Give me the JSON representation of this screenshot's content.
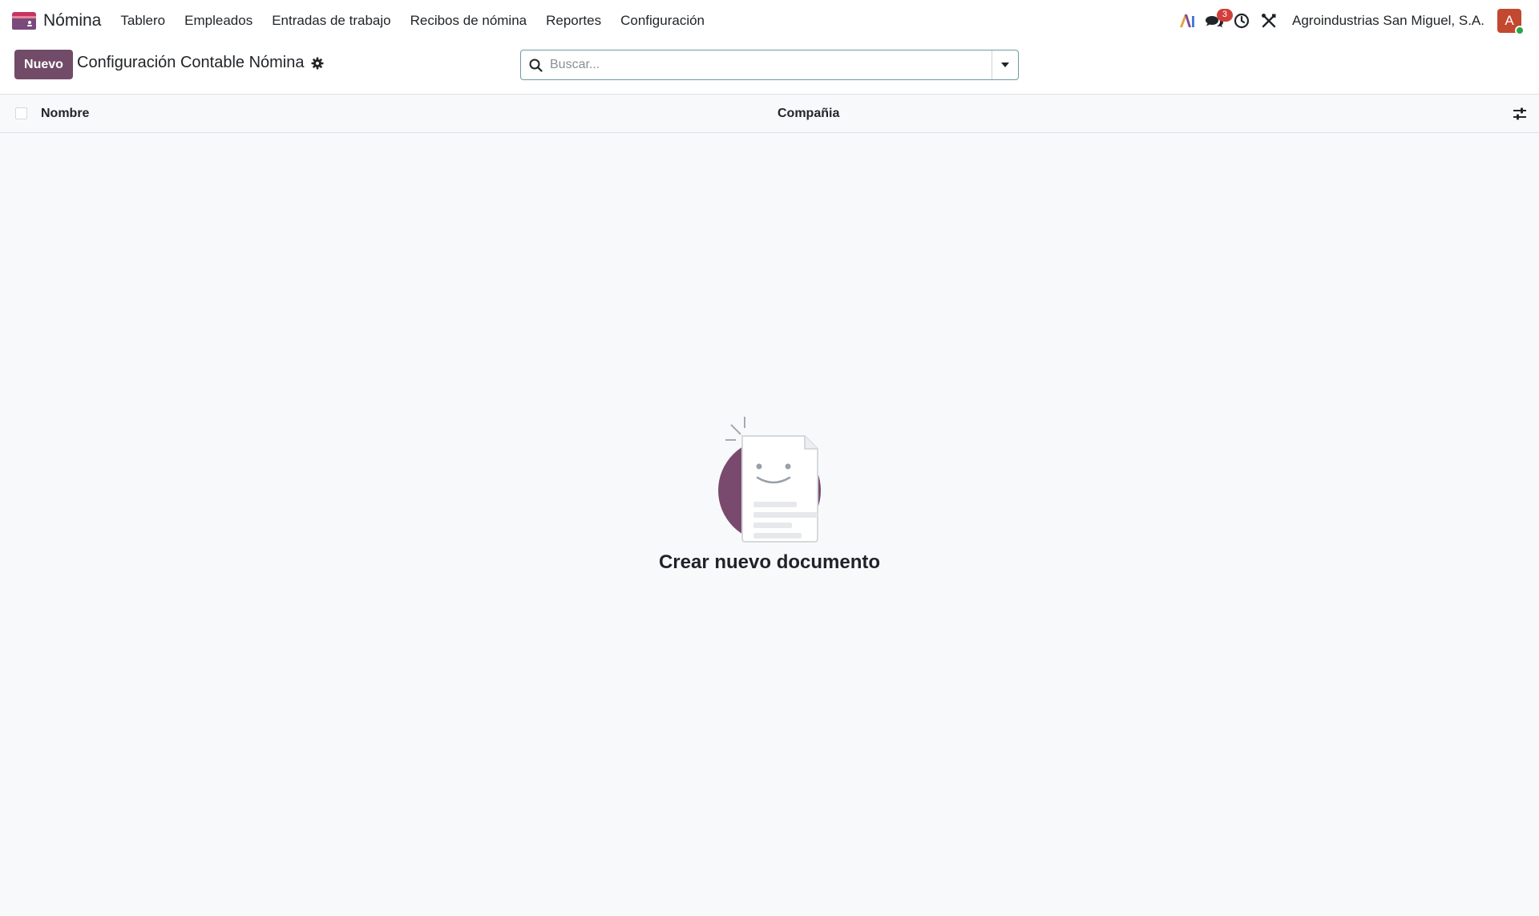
{
  "navbar": {
    "app_name": "Nómina",
    "menu": [
      {
        "label": "Tablero"
      },
      {
        "label": "Empleados"
      },
      {
        "label": "Entradas de trabajo"
      },
      {
        "label": "Recibos de nómina"
      },
      {
        "label": "Reportes"
      },
      {
        "label": "Configuración"
      }
    ],
    "messages_badge": "3",
    "company": "Agroindustrias San Miguel, S.A.",
    "avatar_initial": "A",
    "icons": [
      "ai-icon",
      "chat-icon",
      "clock-icon",
      "tools-icon"
    ]
  },
  "control_panel": {
    "new_label": "Nuevo",
    "title": "Configuración Contable Nómina",
    "search_placeholder": "Buscar..."
  },
  "table": {
    "columns": [
      {
        "label": "Nombre"
      },
      {
        "label": "Compañia"
      }
    ]
  },
  "empty_state": {
    "title": "Crear nuevo documento"
  },
  "colors": {
    "brand": "#714b67",
    "avatar": "#c2482f",
    "badge": "#d23f3a",
    "status_online": "#28a745"
  }
}
